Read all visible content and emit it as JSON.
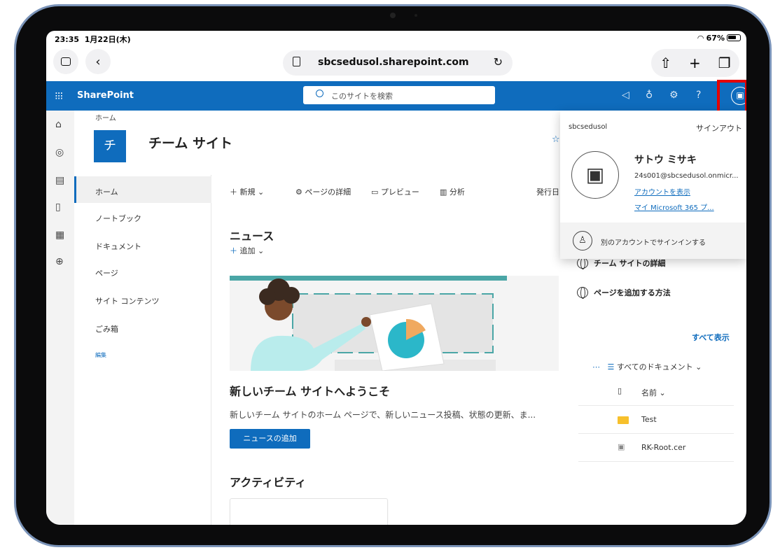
{
  "status": {
    "time": "23:35",
    "date": "1月22日(木)",
    "battery": "67%"
  },
  "browser": {
    "url": "sbcsedusol.sharepoint.com"
  },
  "suite": {
    "app_name": "SharePoint",
    "search_placeholder": "このサイトを検索"
  },
  "site": {
    "breadcrumb": "ホーム",
    "logo_letter": "チ",
    "title": "チーム サイト"
  },
  "nav": {
    "items": [
      "ホーム",
      "ノートブック",
      "ドキュメント",
      "ページ",
      "サイト コンテンツ",
      "ごみ箱"
    ],
    "edit": "編集"
  },
  "commands": {
    "new": "新規",
    "page_details": "ページの詳細",
    "preview": "プレビュー",
    "analytics": "分析",
    "publish_date": "発行日"
  },
  "news": {
    "heading": "ニュース",
    "add": "追加",
    "welcome_heading": "新しいチーム サイトへようこそ",
    "welcome_desc": "新しいチーム サイトのホーム ページで、新しいニュース投稿、状態の更新、ま...",
    "add_news_button": "ニュースの追加"
  },
  "activity": {
    "heading": "アクティビティ"
  },
  "quick_links": [
    "チーム サイトの詳細",
    "ページを追加する方法"
  ],
  "documents": {
    "show_all": "すべて表示",
    "view": "すべてのドキュメント",
    "column_name": "名前",
    "rows": [
      {
        "name": "Test",
        "icon": "folder-icon"
      },
      {
        "name": "RK-Root.cer",
        "icon": "file-icon"
      }
    ]
  },
  "account": {
    "org": "sbcsedusol",
    "sign_out": "サインアウト",
    "name": "サトウ ミサキ",
    "email": "24s001@sbcsedusol.onmicr...",
    "view_account": "アカウントを表示",
    "my_m365": "マイ Microsoft 365 プ...",
    "other_account": "別のアカウントでサインインする"
  },
  "colors": {
    "brand": "#0f6cbd",
    "highlight": "#e50000"
  }
}
